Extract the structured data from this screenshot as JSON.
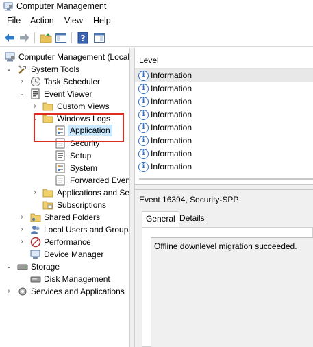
{
  "window": {
    "title": "Computer Management",
    "icon": "computer-management-icon"
  },
  "menu": [
    "File",
    "Action",
    "View",
    "Help"
  ],
  "toolbar": {
    "buttons": [
      "back-arrow-icon",
      "forward-arrow-icon",
      "up-folder-icon",
      "show-hide-console-tree-icon",
      "help-icon",
      "properties-icon"
    ]
  },
  "tree": {
    "items": [
      {
        "label": "Computer Management (Local",
        "icon": "computer-management-icon",
        "state": "expanded"
      },
      {
        "label": "System Tools",
        "icon": "tools-icon",
        "state": "expanded"
      },
      {
        "label": "Task Scheduler",
        "icon": "clock-icon",
        "state": "collapsed"
      },
      {
        "label": "Event Viewer",
        "icon": "event-viewer-icon",
        "state": "expanded"
      },
      {
        "label": "Custom Views",
        "icon": "folder-icon",
        "state": "collapsed"
      },
      {
        "label": "Windows Logs",
        "icon": "folder-icon",
        "state": "expanded"
      },
      {
        "label": "Application",
        "icon": "log-icon",
        "state": "leaf",
        "selected": true
      },
      {
        "label": "Security",
        "icon": "log-icon",
        "state": "leaf"
      },
      {
        "label": "Setup",
        "icon": "log-icon",
        "state": "leaf"
      },
      {
        "label": "System",
        "icon": "log-icon",
        "state": "leaf"
      },
      {
        "label": "Forwarded Event",
        "icon": "log-icon",
        "state": "leaf"
      },
      {
        "label": "Applications and Se",
        "icon": "folder-icon",
        "state": "collapsed"
      },
      {
        "label": "Subscriptions",
        "icon": "subscriptions-icon",
        "state": "leaf"
      },
      {
        "label": "Shared Folders",
        "icon": "shared-folders-icon",
        "state": "collapsed"
      },
      {
        "label": "Local Users and Groups",
        "icon": "users-icon",
        "state": "collapsed"
      },
      {
        "label": "Performance",
        "icon": "performance-icon",
        "state": "collapsed"
      },
      {
        "label": "Device Manager",
        "icon": "device-manager-icon",
        "state": "leaf"
      },
      {
        "label": "Storage",
        "icon": "storage-icon",
        "state": "expanded"
      },
      {
        "label": "Disk Management",
        "icon": "disk-icon",
        "state": "leaf"
      },
      {
        "label": "Services and Applications",
        "icon": "services-icon",
        "state": "collapsed"
      }
    ]
  },
  "events": {
    "column_header": "Level",
    "rows": [
      "Information",
      "Information",
      "Information",
      "Information",
      "Information",
      "Information",
      "Information",
      "Information"
    ]
  },
  "details": {
    "title": "Event 16394, Security-SPP",
    "tabs": [
      "General",
      "Details"
    ],
    "active_tab": "General",
    "message": "Offline downlevel migration succeeded."
  },
  "colors": {
    "highlight_box": "#e02b20",
    "selection": "#cce8ff",
    "info_icon": "#2e6bc6"
  }
}
